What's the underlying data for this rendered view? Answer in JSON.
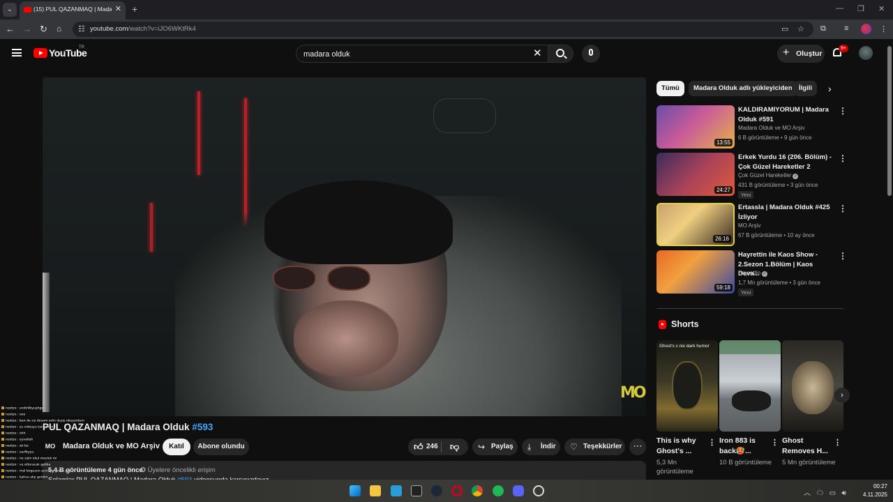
{
  "browser": {
    "tab_title": "(15) PUL QAZANMAQ | Madara",
    "url_host": "youtube.com",
    "url_path": "/watch?v=iJO6WKtRk4"
  },
  "masthead": {
    "logo_text": "YouTube",
    "country": "TR",
    "search_value": "madara olduk",
    "create_label": "Oluştur",
    "notif_badge": "9+"
  },
  "video": {
    "title": "PUL QAZANMAQ | Madara Olduk",
    "title_hash": "#593",
    "channel_avatar_text": "MO",
    "channel_name": "Madara Olduk ve MO Arşiv",
    "join_label": "Katıl",
    "subscribed_label": "Abone olundu",
    "like_count": "246",
    "share_label": "Paylaş",
    "download_label": "İndir",
    "thanks_label": "Teşekkürler",
    "views_date": "5,4 B görüntüleme  4 gün önce",
    "members_first": "Üyelere öncelikli erişim",
    "desc_prefix": "Selamlar PUL QAZANMAQ | Madara Olduk",
    "desc_hash": "#593",
    "desc_suffix": "videosunda karşınızdayız",
    "watermark": "MO"
  },
  "chat_overlay": [
    "nextzo : endirilbyuyhgen",
    "nextzo : ooo",
    "nextzo : ben de siz devam edin dsyip okuyordum",
    "nextzo : su videoyu tanıyorum",
    "nextzo : ohh",
    "nextzo : eyvallah",
    "nextzo : ah be",
    "nextzo : eerfbyyu",
    "nextzo : ne sizin okul meslek mi",
    "nextzo : ve ottoracak galiba",
    "nextzo : mal boguzun acmaya gerek yok",
    "nextzo : kahve alip geldim",
    "nextzo : oglum ustrender ya bizim bilgileri ondan",
    "nextzo : kara harpte aldi ya",
    "nextzo : huasmn videoları ac"
  ],
  "chips": [
    "Tümü",
    "Madara Olduk adlı yükleyiciden",
    "İlgili"
  ],
  "recommendations": [
    {
      "title": "KALDIRAMIYORUM | Madara Olduk #591",
      "channel": "Madara Olduk ve MO Arşiv",
      "meta": "6 B görüntüleme • 9 gün önce",
      "duration": "13:55",
      "verified": false,
      "badge": ""
    },
    {
      "title": "Erkek Yurdu 16 (206. Bölüm) - Çok Güzel Hareketler 2",
      "channel": "Çok Güzel Hareketler",
      "meta": "431 B görüntüleme • 3 gün önce",
      "duration": "24:27",
      "verified": true,
      "badge": "Yeni"
    },
    {
      "title": "Ertassla | Madara Olduk #425 İzliyor",
      "channel": "MO Arşiv",
      "meta": "67 B görüntüleme • 10 ay önce",
      "duration": "26:16",
      "verified": false,
      "badge": ""
    },
    {
      "title": "Hayrettin ile Kaos Show - 2.Sezon 1.Bölüm | Kaos Deva...",
      "channel": "Hayrettin",
      "meta": "1,7 Mn görüntüleme • 3 gün önce",
      "duration": "59:18",
      "verified": true,
      "badge": "Yeni"
    }
  ],
  "shorts": {
    "heading": "Shorts",
    "items": [
      {
        "title": "This is why Ghost's ...",
        "views": "5,3 Mn görüntüleme",
        "caption": "Ghost's c nix dark humor"
      },
      {
        "title": "Iron 883 is back🥵...",
        "views": "10 B görüntüleme",
        "caption": ""
      },
      {
        "title": "Ghost Removes H...",
        "views": "5 Mn görüntüleme",
        "caption": ""
      }
    ]
  },
  "taskbar": {
    "time": "00:27",
    "date": "4.11.2025"
  },
  "colors": {
    "yt_red": "#ff0000",
    "link_blue": "#3ea6ff",
    "surface": "#272727",
    "background": "#0f0f0f"
  }
}
